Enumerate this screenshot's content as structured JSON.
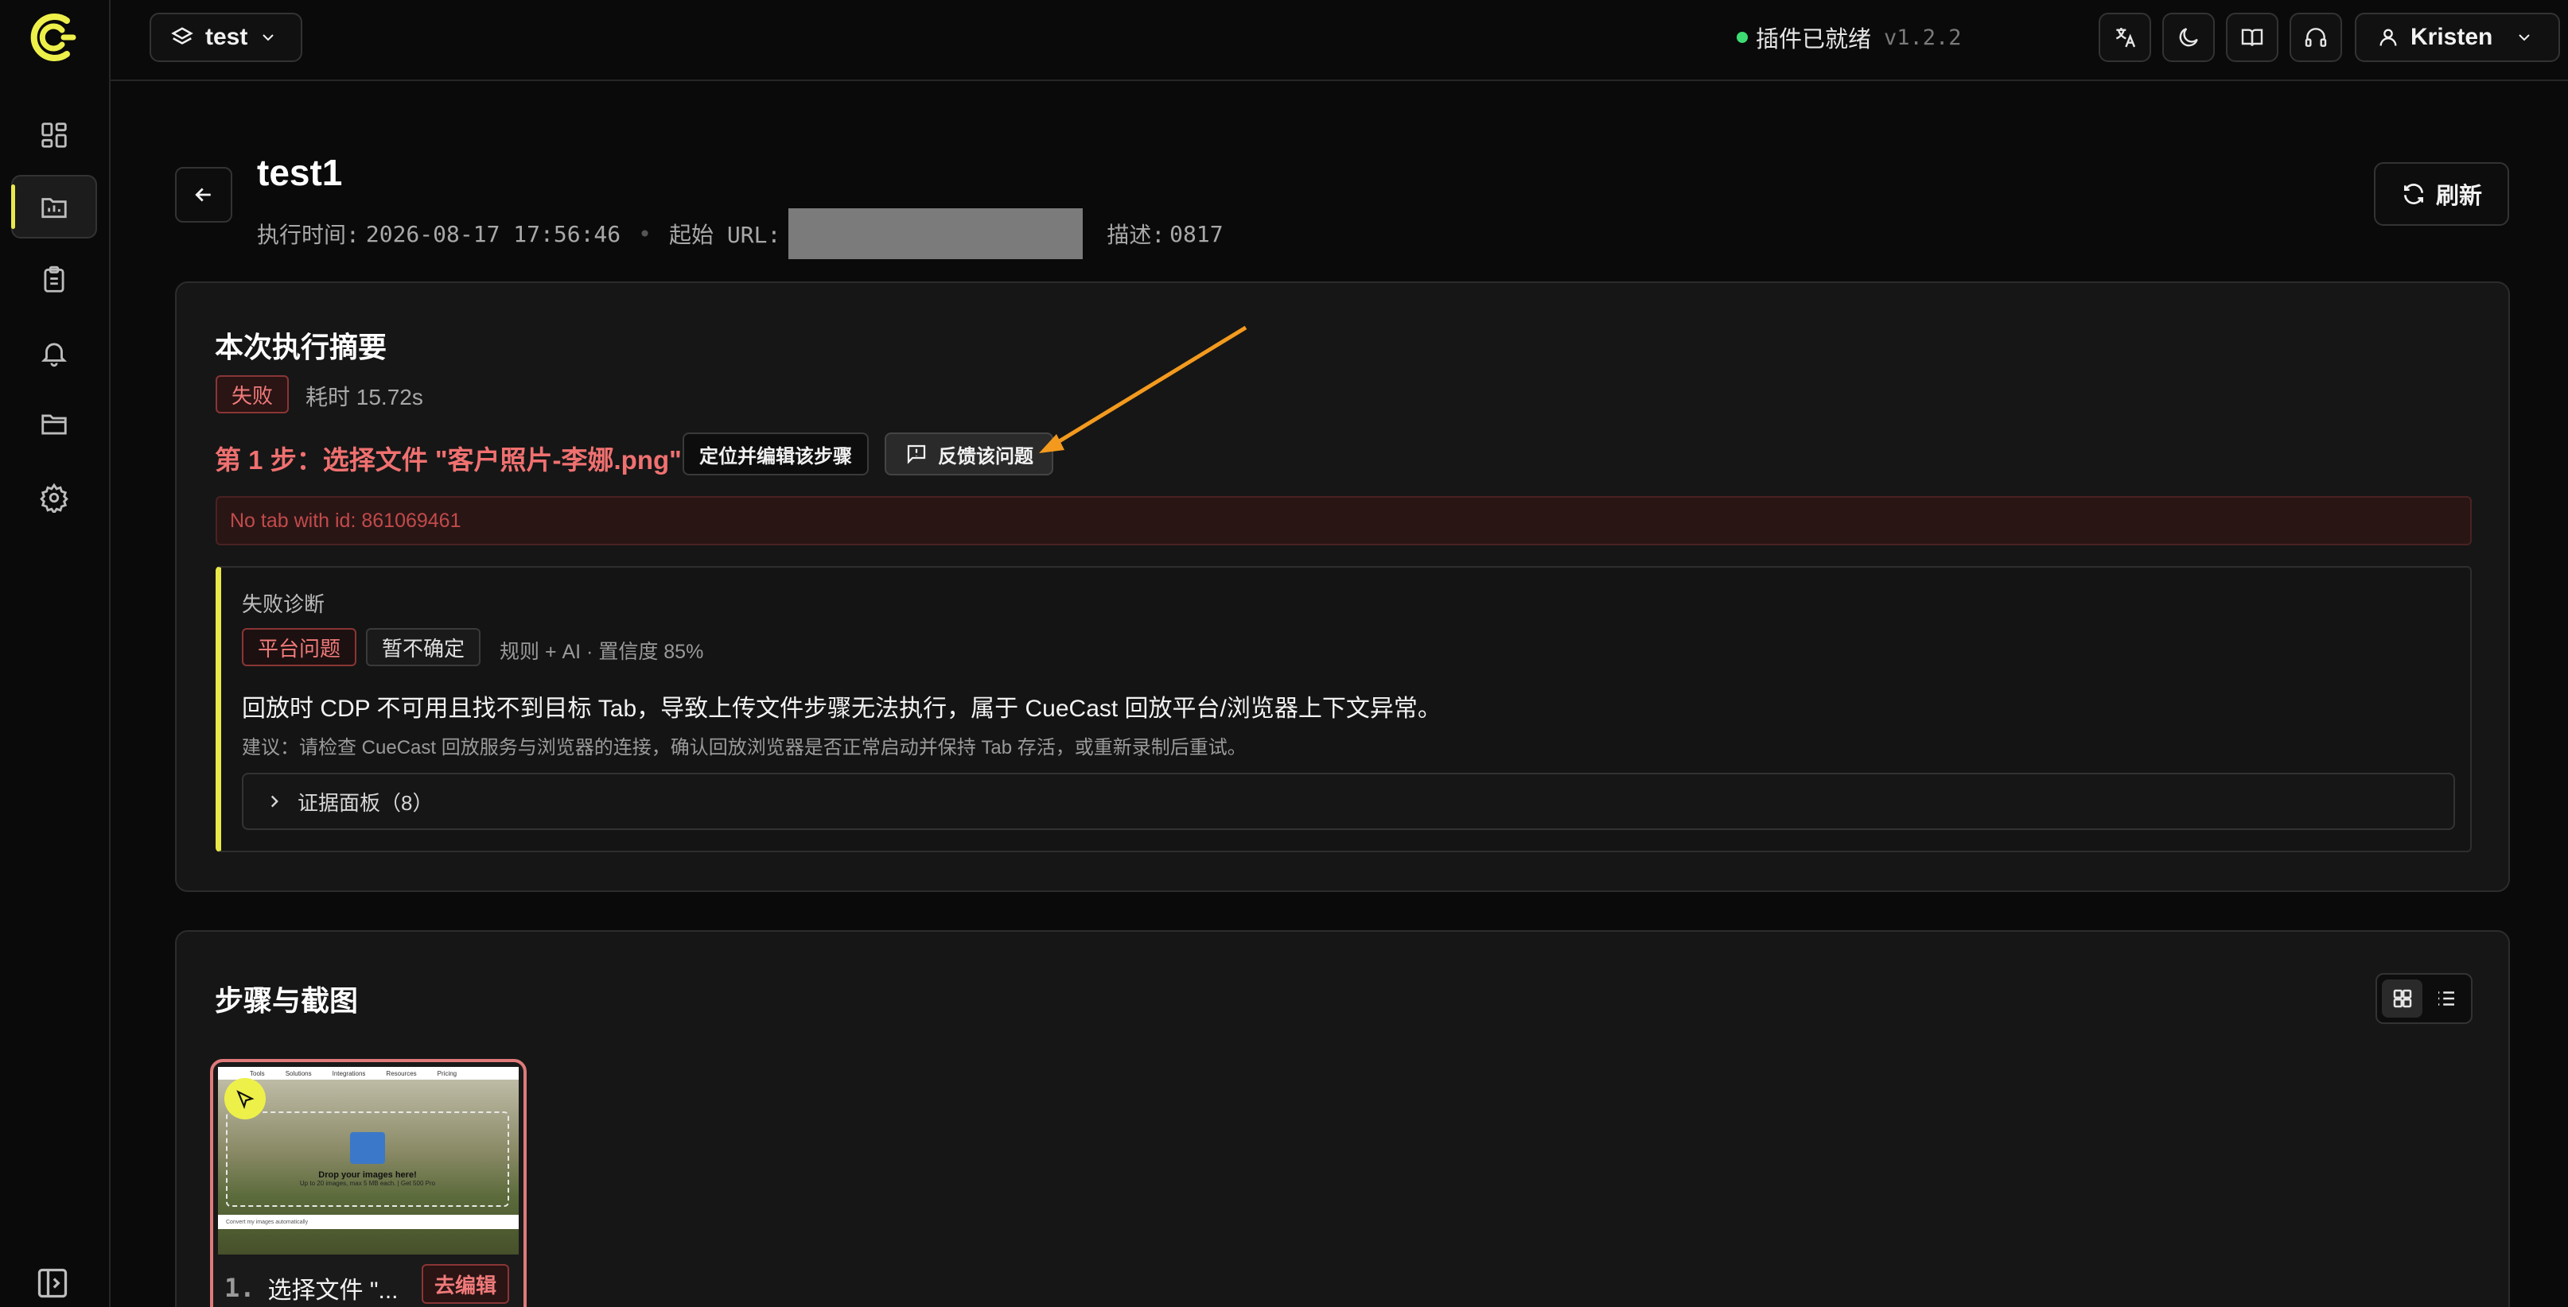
{
  "topbar": {
    "workspace_name": "test",
    "status_text": "插件已就绪",
    "version": "v1.2.2",
    "user_name": "Kristen"
  },
  "sidebar": {
    "items": [
      {
        "name": "dashboard",
        "icon": "dashboard-icon"
      },
      {
        "name": "reports",
        "icon": "report-icon",
        "active": true
      },
      {
        "name": "tasks",
        "icon": "clipboard-icon"
      },
      {
        "name": "notifications",
        "icon": "bell-icon"
      },
      {
        "name": "files",
        "icon": "folder-icon"
      },
      {
        "name": "settings",
        "icon": "gear-icon"
      }
    ]
  },
  "header": {
    "title": "test1",
    "exec_time_label": "执行时间:",
    "exec_time": "2026-08-17 17:56:46",
    "start_url_label": "起始 URL:",
    "desc_label": "描述:",
    "desc": "0817",
    "refresh_label": "刷新"
  },
  "summary": {
    "title": "本次执行摘要",
    "status": "失败",
    "duration": "耗时 15.72s",
    "step_title": "第 1 步：选择文件 \"客户照片-李娜.png\"",
    "locate_button": "定位并编辑该步骤",
    "feedback_button": "反馈该问题",
    "error": "No tab with id: 861069461",
    "diagnosis": {
      "label": "失败诊断",
      "tag_platform": "平台问题",
      "tag_unsure": "暂不确定",
      "meta": "规则 + AI · 置信度 85%",
      "text": "回放时 CDP 不可用且找不到目标 Tab，导致上传文件步骤无法执行，属于 CueCast 回放平台/浏览器上下文异常。",
      "suggestion": "建议：请检查 CueCast 回放服务与浏览器的连接，确认回放浏览器是否正常启动并保持 Tab 存活，或重新录制后重试。",
      "evidence": "证据面板（8）"
    }
  },
  "steps": {
    "title": "步骤与截图",
    "items": [
      {
        "num": "1.",
        "label": "选择文件 \"...",
        "edit": "去编辑",
        "thumb_nav": [
          "Tools",
          "Solutions",
          "Integrations",
          "Resources",
          "Pricing"
        ],
        "thumb_title": "Drop your images here!",
        "thumb_sub": "Up to 20 images, max 5 MB each. | Get 500 Pro",
        "thumb_bar": "Convert my images automatically"
      }
    ]
  },
  "colors": {
    "accent": "#e8e84a",
    "error": "#f07070",
    "status_ok": "#3ddc72",
    "annotation_arrow": "#f39a1e"
  }
}
